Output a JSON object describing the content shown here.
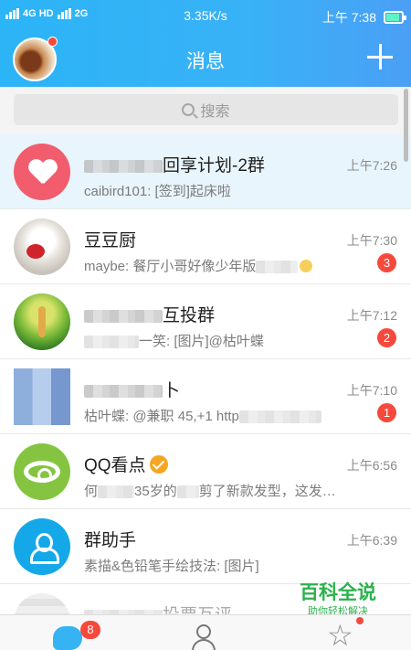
{
  "status_bar": {
    "network_left": "4G HD",
    "network_right": "2G",
    "speed": "3.35K/s",
    "time": "上午 7:38"
  },
  "header": {
    "title": "消息"
  },
  "search": {
    "placeholder": "搜索"
  },
  "conversations": [
    {
      "name_visible": "回享计划-2群",
      "message": "caibird101: [签到]起床啦",
      "time": "上午7:26",
      "badge": ""
    },
    {
      "name_visible": "豆豆厨",
      "message": "maybe: 餐厅小哥好像少年版",
      "time": "上午7:30",
      "badge": "3"
    },
    {
      "name_visible": "互投群",
      "message": "一笑: [图片]@枯叶蝶",
      "time": "上午7:12",
      "badge": "2"
    },
    {
      "name_visible": "卜",
      "message": "枯叶蝶: @兼职 45,+1 http",
      "time": "上午7:10",
      "badge": "1"
    },
    {
      "name_visible": "QQ看点",
      "message_prefix": "何",
      "message": "35岁的",
      "message_suffix": "剪了新款发型，这发…",
      "time": "上午6:56",
      "badge": ""
    },
    {
      "name_visible": "群助手",
      "message": "素描&色铅笔手绘技法: [图片]",
      "time": "上午6:39",
      "badge": ""
    },
    {
      "name_visible": "投票互评",
      "message": "",
      "time": "",
      "badge": ""
    }
  ],
  "tabbar": {
    "messages_badge": "8"
  },
  "watermark": {
    "title": "百科全说",
    "subtitle": "助你轻松解决"
  },
  "icons": {
    "add": "plus-icon",
    "search": "search-icon",
    "messages_tab": "chat-bubble-icon",
    "contacts_tab": "person-icon",
    "trends_tab": "star-icon"
  },
  "colors": {
    "header_blue": "#2bb4f6",
    "badge_red": "#f5493c",
    "pinned_row": "#e9f5fd"
  }
}
